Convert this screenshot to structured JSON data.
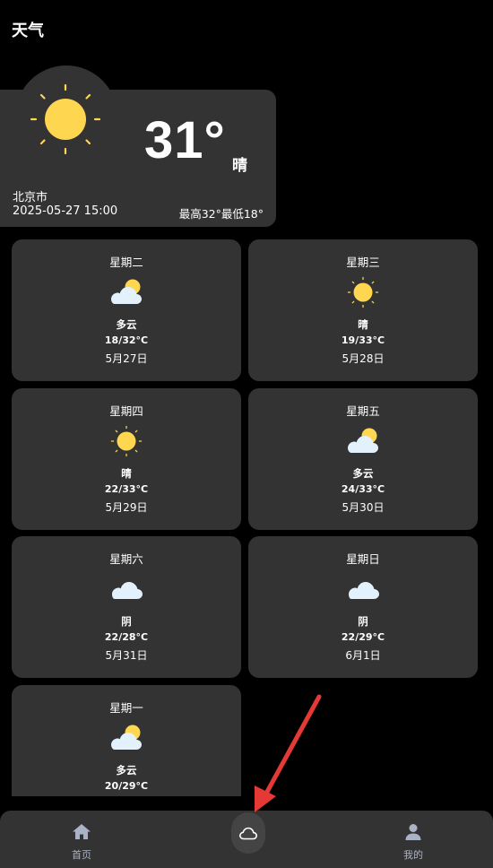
{
  "page": {
    "title": "天气"
  },
  "current": {
    "temperature": "31°",
    "condition": "晴",
    "city": "北京市",
    "datetime": "2025-05-27 15:00",
    "range": "最高32°最低18°",
    "icon": "sun-icon"
  },
  "forecast": [
    {
      "day": "星期二",
      "condition": "多云",
      "temp": "18/32°C",
      "date": "5月27日",
      "icon": "partly-cloudy-icon"
    },
    {
      "day": "星期三",
      "condition": "晴",
      "temp": "19/33°C",
      "date": "5月28日",
      "icon": "sun-icon"
    },
    {
      "day": "星期四",
      "condition": "晴",
      "temp": "22/33°C",
      "date": "5月29日",
      "icon": "sun-icon"
    },
    {
      "day": "星期五",
      "condition": "多云",
      "temp": "24/33°C",
      "date": "5月30日",
      "icon": "partly-cloudy-icon"
    },
    {
      "day": "星期六",
      "condition": "阴",
      "temp": "22/28°C",
      "date": "5月31日",
      "icon": "cloud-icon"
    },
    {
      "day": "星期日",
      "condition": "阴",
      "temp": "22/29°C",
      "date": "6月1日",
      "icon": "cloud-icon"
    },
    {
      "day": "星期一",
      "condition": "多云",
      "temp": "20/29°C",
      "date": "",
      "icon": "partly-cloudy-icon"
    }
  ],
  "nav": {
    "home_label": "首页",
    "weather_icon": "cloud-outline-icon",
    "profile_label": "我的"
  },
  "colors": {
    "background": "#000000",
    "card": "#333333",
    "sun": "#FFD64F",
    "cloud": "#E3F1FC",
    "nav_label": "#AAB3C5",
    "arrow": "#E53935"
  }
}
